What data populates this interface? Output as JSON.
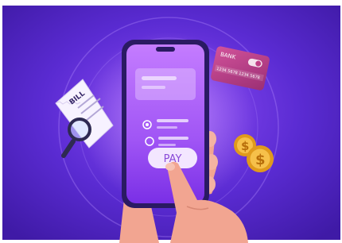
{
  "bill": {
    "title": "BILL"
  },
  "bank_card": {
    "label": "BANK",
    "number": "1234 5678 1234 5678"
  },
  "phone": {
    "pay_label": "PAY"
  },
  "colors": {
    "background_center": "#7a3df0",
    "background_edge": "#3f1aa6",
    "phone_screen_top": "#c47cff",
    "phone_screen_bottom": "#7a2fe6",
    "card": "#c23f86",
    "coin": "#f2b42a",
    "skin": "#f3a792"
  },
  "icons": [
    "bill-icon",
    "magnifier-icon",
    "bank-card-icon",
    "coin-icon",
    "hand-icon",
    "radio-icon"
  ]
}
